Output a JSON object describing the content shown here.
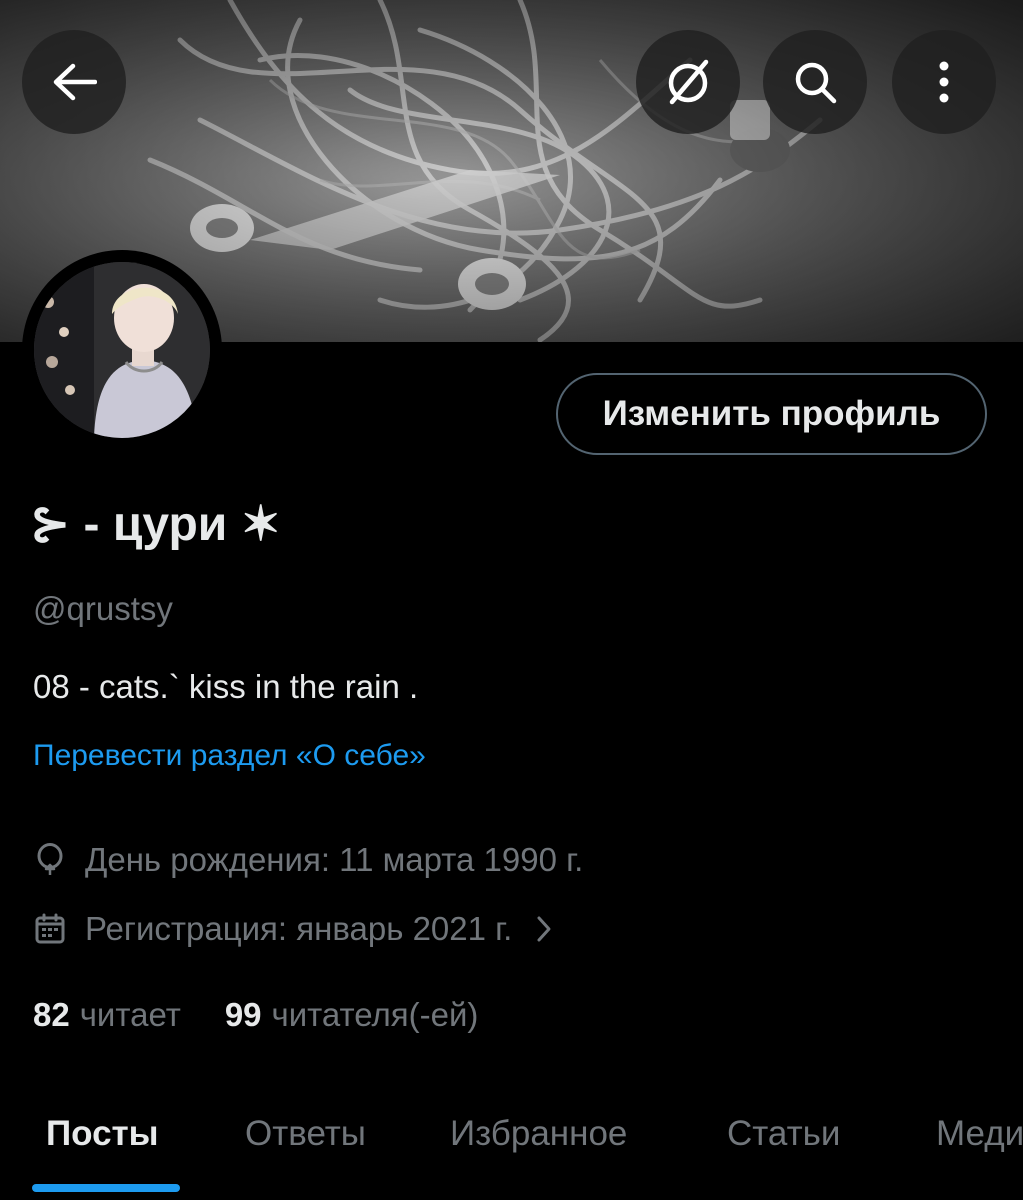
{
  "header": {
    "back_icon": "arrow-left-icon",
    "grok_icon": "grok-slash-circle-icon",
    "search_icon": "search-icon",
    "more_icon": "more-vertical-icon"
  },
  "profile": {
    "display_name": "⊱ - цури ✶",
    "handle": "@qrustsy",
    "bio": "08 - cats.` kiss in the rain .",
    "translate_link": "Перевести раздел «О себе»",
    "birthday": "День рождения: 11 марта 1990 г.",
    "joined": "Регистрация: январь 2021 г.",
    "edit_button": "Изменить профиль"
  },
  "stats": {
    "following_count": "82",
    "following_label": "читает",
    "followers_count": "99",
    "followers_label": "читателя(-ей)"
  },
  "tabs": [
    {
      "label": "Посты",
      "active": true
    },
    {
      "label": "Ответы",
      "active": false
    },
    {
      "label": "Избранное",
      "active": false
    },
    {
      "label": "Статьи",
      "active": false
    },
    {
      "label": "Медиа",
      "active": false
    }
  ],
  "colors": {
    "background": "#000000",
    "text_primary": "#e7e9ea",
    "text_secondary": "#71767b",
    "accent": "#1d9bf0",
    "border": "#536471"
  }
}
